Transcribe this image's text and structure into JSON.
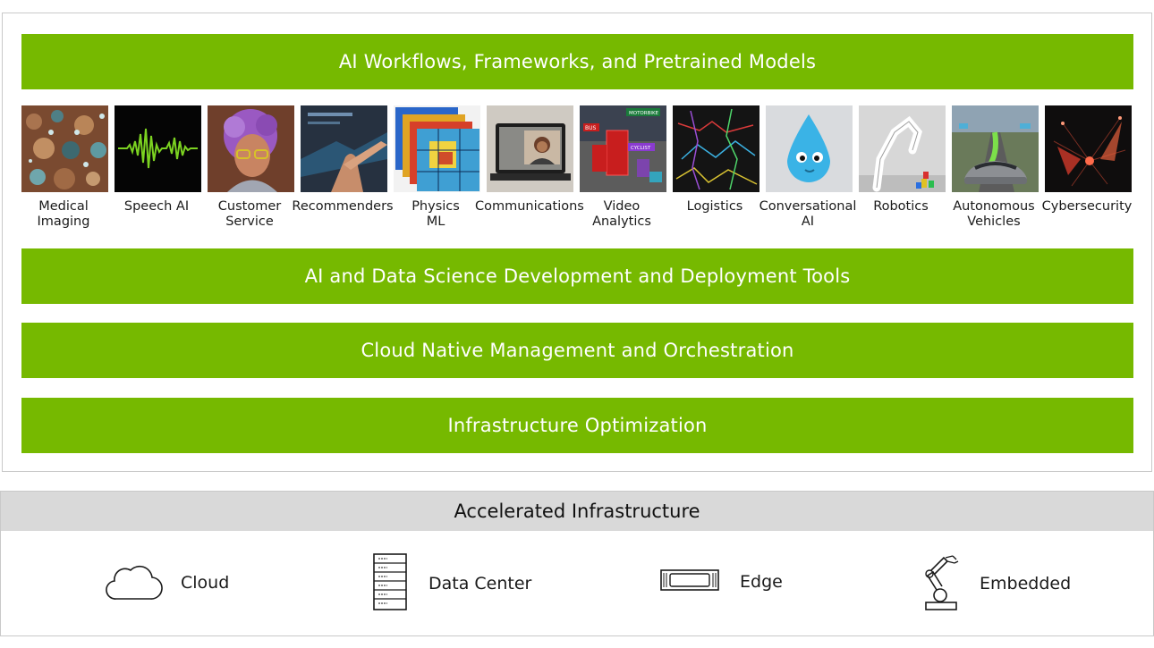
{
  "top_stack": {
    "workflows_bar": "AI Workflows, Frameworks, and Pretrained Models",
    "tools_bar": "AI and Data Science Development and Deployment Tools",
    "cloud_native_bar": "Cloud Native Management and Orchestration",
    "infra_opt_bar": "Infrastructure Optimization"
  },
  "use_cases": [
    {
      "label": "Medical\nImaging",
      "icon": "medical-imaging-thumbnail"
    },
    {
      "label": "Speech AI",
      "icon": "speech-waveform-thumbnail"
    },
    {
      "label": "Customer\nService",
      "icon": "avatar-thumbnail"
    },
    {
      "label": "Recommenders",
      "icon": "touchscreen-thumbnail"
    },
    {
      "label": "Physics\nML",
      "icon": "heatmap-thumbnail"
    },
    {
      "label": "Communications",
      "icon": "video-call-thumbnail"
    },
    {
      "label": "Video\nAnalytics",
      "icon": "street-detection-thumbnail"
    },
    {
      "label": "Logistics",
      "icon": "route-map-thumbnail"
    },
    {
      "label": "Conversational\nAI",
      "icon": "droplet-character-thumbnail"
    },
    {
      "label": "Robotics",
      "icon": "robot-arm-thumbnail"
    },
    {
      "label": "Autonomous\nVehicles",
      "icon": "car-thumbnail"
    },
    {
      "label": "Cybersecurity",
      "icon": "network-burst-thumbnail"
    }
  ],
  "video_tags": {
    "tag1": "MOTORBIKE",
    "tag2": "BUS",
    "tag3": "CYCLIST"
  },
  "infrastructure": {
    "title": "Accelerated Infrastructure",
    "items": [
      {
        "label": "Cloud",
        "icon": "cloud-icon"
      },
      {
        "label": "Data Center",
        "icon": "server-rack-icon"
      },
      {
        "label": "Edge",
        "icon": "edge-device-icon"
      },
      {
        "label": "Embedded",
        "icon": "robot-arm-icon"
      }
    ]
  },
  "colors": {
    "accent_green": "#76b900",
    "header_gray": "#d9d9d9",
    "border_gray": "#c9c9c9"
  }
}
